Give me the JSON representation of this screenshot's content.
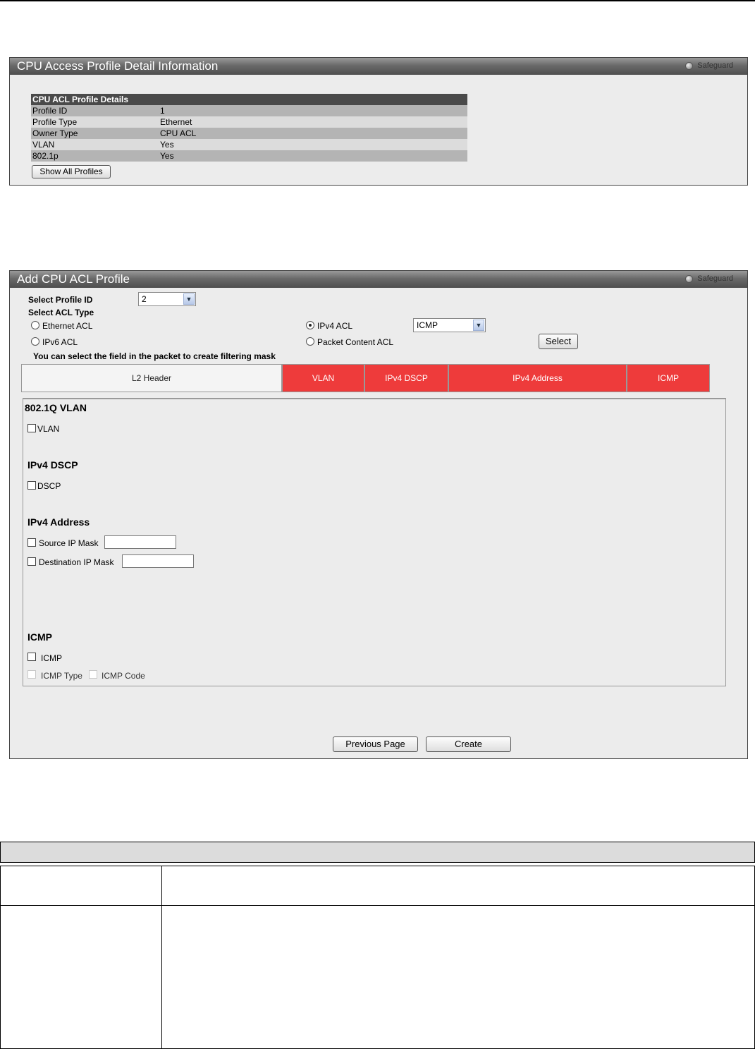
{
  "panel1": {
    "title": "CPU Access Profile Detail Information",
    "safeguard": "Safeguard",
    "table_header": "CPU ACL Profile Details",
    "rows": [
      {
        "label": "Profile ID",
        "value": "1"
      },
      {
        "label": "Profile Type",
        "value": "Ethernet"
      },
      {
        "label": "Owner Type",
        "value": "CPU ACL"
      },
      {
        "label": "VLAN",
        "value": "Yes"
      },
      {
        "label": "802.1p",
        "value": "Yes"
      }
    ],
    "show_all_button": "Show All Profiles"
  },
  "panel2": {
    "title": "Add CPU ACL Profile",
    "safeguard": "Safeguard",
    "select_profile_id_label": "Select Profile ID",
    "profile_id_value": "2",
    "select_acl_type_label": "Select ACL Type",
    "acl_types": {
      "ethernet": "Ethernet ACL",
      "ipv4": "IPv4 ACL",
      "ipv6": "IPv6 ACL",
      "packet_content": "Packet Content ACL",
      "selected": "IPv4 ACL"
    },
    "ipv4_protocol_value": "ICMP",
    "select_button": "Select",
    "hint": "You can select the field in the packet to create filtering mask",
    "tabs": [
      "L2 Header",
      "VLAN",
      "IPv4 DSCP",
      "IPv4 Address",
      "ICMP"
    ],
    "sections": {
      "vlan": {
        "title": "802.1Q VLAN",
        "checkbox": "VLAN"
      },
      "dscp": {
        "title": "IPv4 DSCP",
        "checkbox": "DSCP"
      },
      "address": {
        "title": "IPv4 Address",
        "source_mask": "Source IP Mask",
        "destination_mask": "Destination IP Mask"
      },
      "icmp": {
        "title": "ICMP",
        "checkbox": "ICMP",
        "type": "ICMP Type",
        "code": "ICMP Code"
      }
    },
    "previous_button": "Previous Page",
    "create_button": "Create"
  },
  "colors": {
    "tab_active": "#ee3b3b",
    "title_bar": "#5a5a5a",
    "panel_bg": "#ececec"
  }
}
